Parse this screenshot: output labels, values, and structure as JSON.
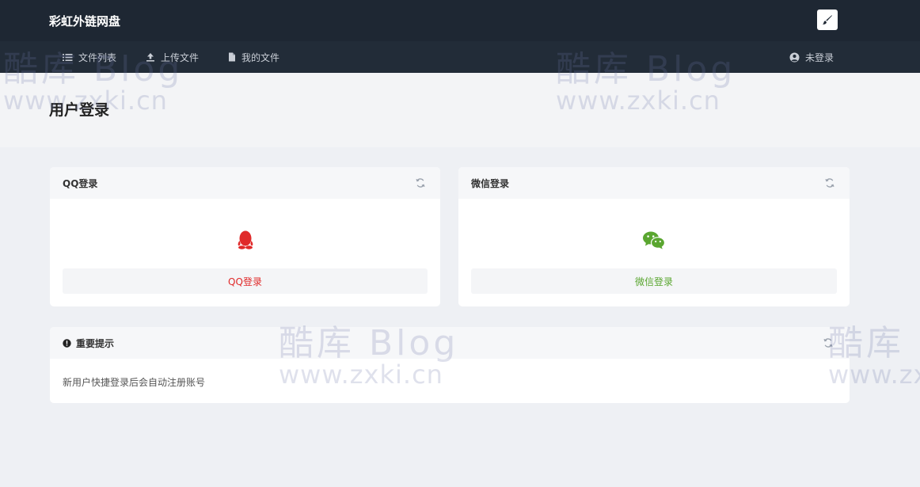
{
  "app": {
    "title": "彩虹外链网盘"
  },
  "nav": {
    "items": [
      {
        "label": "文件列表",
        "icon": "list-icon"
      },
      {
        "label": "上传文件",
        "icon": "upload-icon"
      },
      {
        "label": "我的文件",
        "icon": "file-icon"
      }
    ],
    "user_label": "未登录",
    "user_icon": "user-circle-icon"
  },
  "page": {
    "title": "用户登录"
  },
  "qq_card": {
    "title": "QQ登录",
    "button_label": "QQ登录",
    "accent": "#e02a2a",
    "icon": "qq-penguin-icon"
  },
  "wechat_card": {
    "title": "微信登录",
    "button_label": "微信登录",
    "accent": "#5aa630",
    "icon": "wechat-icon"
  },
  "notice_card": {
    "title": "重要提示",
    "text": "新用户快捷登录后会自动注册账号",
    "icon": "exclamation-circle-icon"
  },
  "watermark": {
    "line1": "酷库 Blog",
    "line2": "www.zxki.cn"
  },
  "colors": {
    "topbar": "#1e2733",
    "navbar": "#222c38",
    "background": "#eef0f4"
  }
}
